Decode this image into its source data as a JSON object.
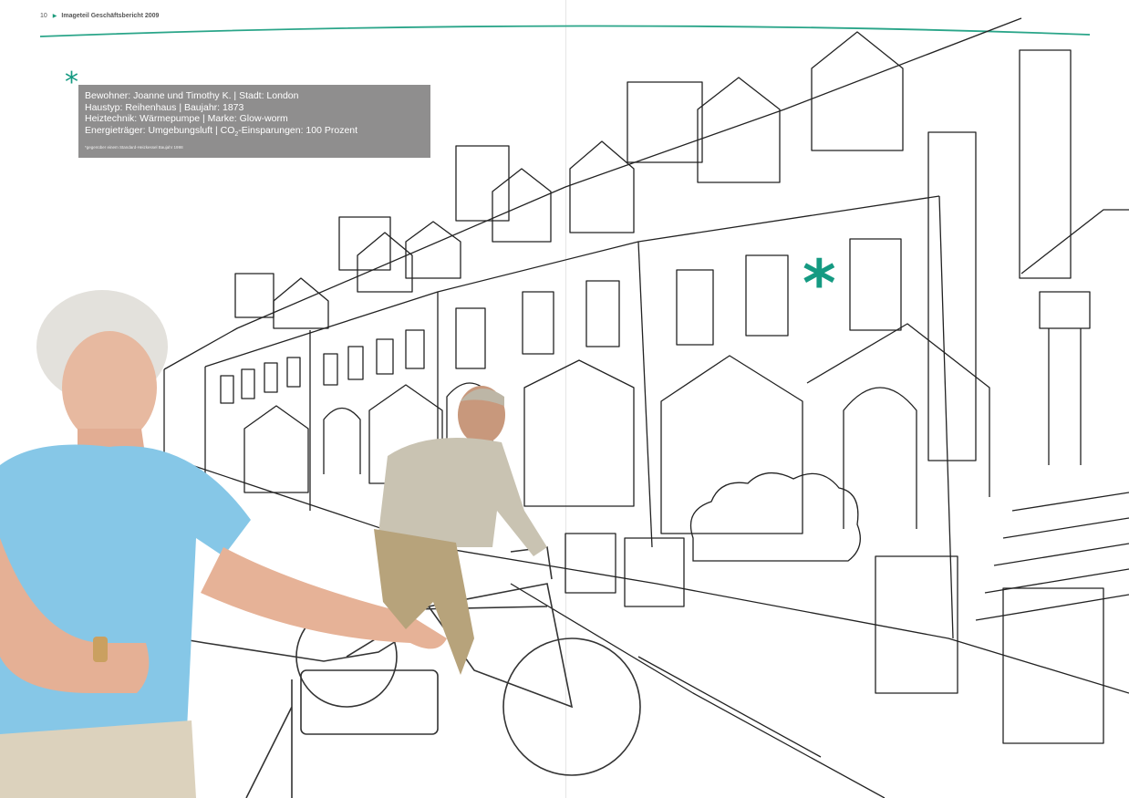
{
  "header": {
    "page_number": "10",
    "title": "Imageteil Geschäftsbericht 2009",
    "accent_color": "#159a82"
  },
  "info_box": {
    "asterisk": "*",
    "line1": "Bewohner: Joanne und Timothy K. | Stadt: London",
    "line2": "Haustyp: Reihenhaus | Baujahr: 1873",
    "line3": "Heiztechnik: Wärmepumpe | Marke: Glow-worm",
    "line4_prefix": "Energieträger: Umgebungsluft | CO",
    "line4_sub": "2",
    "line4_suffix": "-Einsparungen: 100 Prozent",
    "footnote": "*gegenüber einem Standard-Heizkessel Baujahr 1998",
    "background_color": "#8f8e8e"
  },
  "illustration": {
    "asterisk": "*",
    "asterisk_color": "#159a82"
  }
}
